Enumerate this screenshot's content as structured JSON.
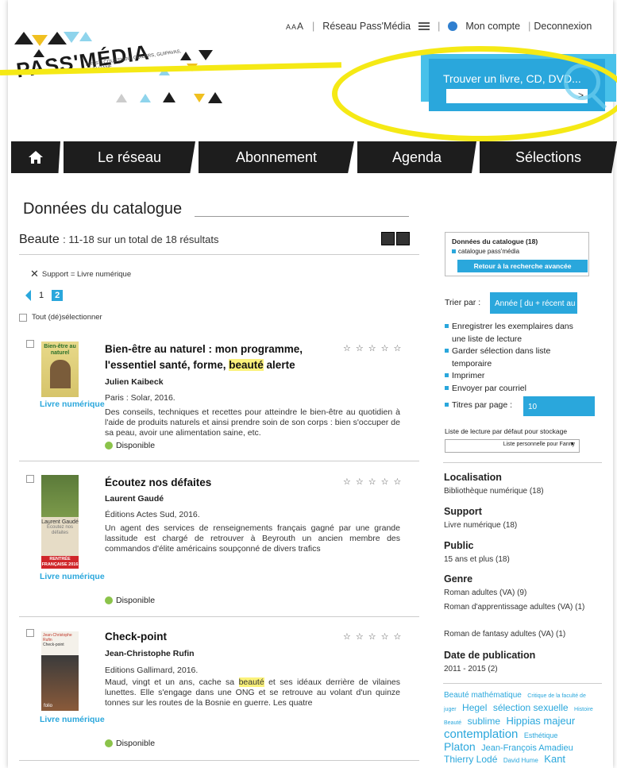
{
  "header": {
    "aaa": [
      "A",
      "A",
      "A"
    ],
    "network_link": "Réseau Pass'Média",
    "account": "Mon compte",
    "logout": "Deconnexion",
    "logo_text": "PASS'MÉDIA",
    "logo_subtitle": "BREST, COUESNOU, GUILERS, GUIPAVAS, PLOUZANÉ"
  },
  "search": {
    "label": "Trouver un livre, CD, DVD...",
    "placeholder": "",
    "go": ">"
  },
  "nav": {
    "items": [
      "Le réseau",
      "Abonnement",
      "Agenda",
      "Sélections"
    ]
  },
  "main": {
    "heading": "Données du catalogue",
    "query": "Beaute",
    "results_summary": ": 11-18 sur un total de 18 résultats",
    "filter_label": "Support = Livre numérique",
    "pages": [
      "1",
      "2"
    ],
    "select_all": "Tout (dé)sélectionner"
  },
  "records": [
    {
      "title_before": "Bien-être au naturel : mon programme, l'essentiel santé, forme, ",
      "title_highlight": "beauté",
      "title_after": " alerte",
      "author": "Julien Kaibeck",
      "publisher": "Paris : Solar, 2016.",
      "description": "Des conseils, techniques et recettes pour atteindre le bien-être au quotidien à l'aide de produits naturels et ainsi prendre soin de son corps : bien s'occuper de sa peau, avoir une alimentation saine, etc.",
      "type": "Livre numérique",
      "availability": "Disponible",
      "cover_text": "Bien-être au naturel"
    },
    {
      "title": "Écoutez nos défaites",
      "author": "Laurent Gaudé",
      "publisher": "Éditions Actes Sud, 2016.",
      "description": "Un agent des services de renseignements français gagné par une grande lassitude est chargé de retrouver à Beyrouth un ancien membre des commandos d'élite américains soupçonné de divers trafics",
      "type": "Livre numérique",
      "availability": "Disponible",
      "cover_author": "Laurent Gaudé",
      "cover_title": "Écoutez nos défaites",
      "cover_badge": "RENTRÉE FRANÇAISE 2016"
    },
    {
      "title": "Check-point",
      "author": "Jean-Christophe Rufin",
      "publisher": "Editions Gallimard, 2016.",
      "description_before": "Maud, vingt et un ans, cache sa ",
      "description_highlight": "beauté",
      "description_after": " et ses idéaux derrière de vilaines lunettes. Elle s'engage dans une ONG et se retrouve au volant d'un quinze tonnes sur les routes de la Bosnie en guerre. Les quatre",
      "type": "Livre numérique",
      "availability": "Disponible",
      "cover_author": "Jean-Christophe Rufin",
      "cover_title": "Check-point",
      "cover_publisher": "folio"
    }
  ],
  "sidebar": {
    "facet_box": {
      "title": "Données du catalogue (18)",
      "item": "catalogue pass'média",
      "button": "Retour à la recherche avancée"
    },
    "sort_label": "Trier par :",
    "sort_value": "Année [ du + récent au",
    "actions": [
      "Enregistrer les exemplaires dans une liste de lecture",
      "Garder sélection dans liste temporaire",
      "Imprimer",
      "Envoyer par courriel"
    ],
    "per_page_label": "Titres par page :",
    "per_page_value": "10",
    "list_label": "Liste de lecture par défaut pour stockage",
    "list_value": "Liste personnelle pour Fanny",
    "facets": [
      {
        "title": "Localisation",
        "values": [
          "Bibliothèque numérique (18)"
        ]
      },
      {
        "title": "Support",
        "values": [
          "Livre numérique (18)"
        ]
      },
      {
        "title": "Public",
        "values": [
          "15 ans et plus (18)"
        ]
      },
      {
        "title": "Genre",
        "values": [
          "Roman adultes (VA) (9)",
          "Roman d'apprentissage adultes (VA) (1)",
          "Roman de fantasy adultes (VA) (1)"
        ]
      },
      {
        "title": "Date de publication",
        "values": [
          "2011 - 2015 (2)"
        ]
      }
    ],
    "tag_cloud": [
      {
        "text": "Beauté mathématique",
        "size": 10
      },
      {
        "text": "Critique de la faculté de juger",
        "size": 7
      },
      {
        "text": "Hegel",
        "size": 12
      },
      {
        "text": "sélection sexuelle",
        "size": 12
      },
      {
        "text": "Histoire",
        "size": 7
      },
      {
        "text": "Beauté",
        "size": 7
      },
      {
        "text": "sublime",
        "size": 12
      },
      {
        "text": "Hippias majeur",
        "size": 13
      },
      {
        "text": "contemplation",
        "size": 15
      },
      {
        "text": "Esthétique",
        "size": 9
      },
      {
        "text": "Platon",
        "size": 14
      },
      {
        "text": "Jean-François Amadieu",
        "size": 11
      },
      {
        "text": "Thierry Lodé",
        "size": 12
      },
      {
        "text": "David Hume",
        "size": 8
      },
      {
        "text": "Kant",
        "size": 13
      }
    ]
  },
  "colors": {
    "accent": "#2aa7dc",
    "highlight_ellipse": "#f5e915",
    "nav_bg": "#1d1d1d",
    "available": "#8bc34a"
  }
}
